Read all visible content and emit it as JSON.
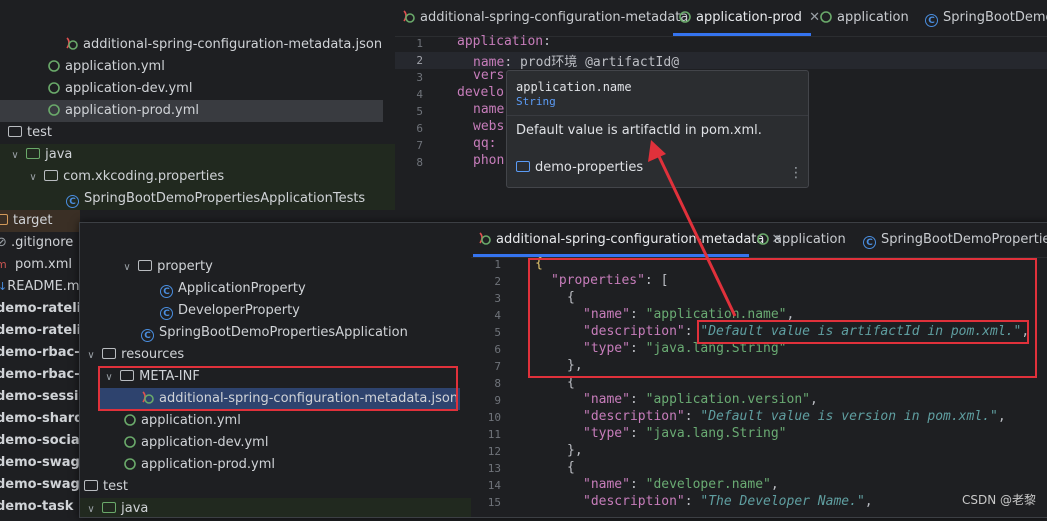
{
  "back_tree": {
    "rows": [
      {
        "label": "additional-spring-configuration-metadata.json"
      },
      {
        "label": "application.yml"
      },
      {
        "label": "application-dev.yml"
      },
      {
        "label": "application-prod.yml"
      },
      {
        "label": "test"
      },
      {
        "label": "java"
      },
      {
        "label": "com.xkcoding.properties"
      },
      {
        "label": "SpringBootDemoPropertiesApplicationTests"
      },
      {
        "label": "target"
      },
      {
        "label": ".gitignore"
      },
      {
        "label": "pom.xml"
      },
      {
        "label": "README.md"
      },
      {
        "label": "demo-ratelimit"
      },
      {
        "label": "demo-ratelimit"
      },
      {
        "label": "demo-rbac-se"
      },
      {
        "label": "demo-rbac-sh"
      },
      {
        "label": "demo-session"
      },
      {
        "label": "demo-sharding"
      },
      {
        "label": "demo-social"
      },
      {
        "label": "demo-swagge"
      },
      {
        "label": "demo-swagge"
      },
      {
        "label": "demo-task"
      }
    ]
  },
  "back_editor": {
    "tabs": [
      {
        "label": "additional-spring-configuration-metadata"
      },
      {
        "label": "application-prod"
      },
      {
        "label": "application"
      },
      {
        "label": "SpringBootDemoPr"
      }
    ],
    "line_numbers": [
      "1",
      "2",
      "3",
      "4",
      "5",
      "6",
      "7",
      "8"
    ],
    "lines": [
      [
        "application",
        ":"
      ],
      [
        "name",
        ": ",
        "prod环境 @artifactId@"
      ],
      [
        "vers"
      ],
      [
        "develo"
      ],
      [
        "name"
      ],
      [
        "webs"
      ],
      [
        "qq:"
      ],
      [
        "phon"
      ]
    ]
  },
  "popup": {
    "title": "application.name",
    "type": "String",
    "description": "Default value is artifactId in pom.xml.",
    "module": "demo-properties",
    "more": "⋮"
  },
  "front_tree": {
    "rows": [
      {
        "label": "property"
      },
      {
        "label": "ApplicationProperty"
      },
      {
        "label": "DeveloperProperty"
      },
      {
        "label": "SpringBootDemoPropertiesApplication"
      },
      {
        "label": "resources"
      },
      {
        "label": "META-INF"
      },
      {
        "label": "additional-spring-configuration-metadata.json"
      },
      {
        "label": "application.yml"
      },
      {
        "label": "application-dev.yml"
      },
      {
        "label": "application-prod.yml"
      },
      {
        "label": "test"
      },
      {
        "label": "java"
      }
    ]
  },
  "front_editor": {
    "tabs": [
      {
        "label": "additional-spring-configuration-metadata"
      },
      {
        "label": "application"
      },
      {
        "label": "SpringBootDemoPropertiesA"
      }
    ],
    "line_numbers": [
      "1",
      "2",
      "3",
      "4",
      "5",
      "6",
      "7",
      "8",
      "9",
      "10",
      "11",
      "12",
      "13",
      "14",
      "15"
    ],
    "lines": {
      "l1": "{",
      "l2_key": "\"properties\"",
      "l2_rest": ": [",
      "l3": "{",
      "l4_key": "\"name\"",
      "l4_val": "\"application.name\"",
      "l5_key": "\"description\"",
      "l5_val": "\"Default value is artifactId in pom.xml.\"",
      "l6_key": "\"type\"",
      "l6_val": "\"java.lang.String\"",
      "l7": "},",
      "l8": "{",
      "l9_key": "\"name\"",
      "l9_val": "\"application.version\"",
      "l10_key": "\"description\"",
      "l10_val": "\"Default value is version in pom.xml.\"",
      "l11_key": "\"type\"",
      "l11_val": "\"java.lang.String\"",
      "l12": "},",
      "l13": "{",
      "l14_key": "\"name\"",
      "l14_val": "\"developer.name\"",
      "l15_key": "\"description\"",
      "l15_val": "\"The Developer Name.\""
    }
  },
  "watermark": "CSDN @老黎",
  "colors": {
    "background": "#1e1f22",
    "highlight_box": "#e0313b",
    "json_key": "#c77dbb",
    "json_string": "#6aab73",
    "json_description": "#5f9ea0",
    "active_tab_underline": "#3574f0"
  }
}
